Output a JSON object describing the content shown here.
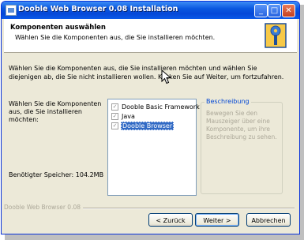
{
  "window": {
    "title": "Dooble Web Browser 0.08 Installation",
    "minimize_glyph": "_",
    "maximize_glyph": "□",
    "close_glyph": "✕"
  },
  "header": {
    "title": "Komponenten auswählen",
    "subtitle": "Wählen Sie die Komponenten aus, die Sie installieren möchten."
  },
  "intro_text": "Wählen Sie die Komponenten aus, die Sie installieren möchten und wählen Sie diejenigen ab, die Sie nicht installieren wollen. Klicken Sie auf Weiter, um fortzufahren.",
  "components": {
    "label": "Wählen Sie die Komponenten aus, die Sie installieren möchten:",
    "items": [
      {
        "label": "Dooble Basic Framework",
        "checked": true,
        "selected": false
      },
      {
        "label": "Java",
        "checked": true,
        "selected": false
      },
      {
        "label": "Dooble Browser",
        "checked": true,
        "selected": true
      }
    ]
  },
  "description": {
    "title": "Beschreibung",
    "text": "Bewegen Sie den Mauszeiger über eine Komponente, um ihre Beschreibung zu sehen."
  },
  "required_space": "Benötigter Speicher: 104.2MB",
  "branding": "Dooble Web Browser 0.08",
  "buttons": {
    "back": "< Zurück",
    "next": "Weiter >",
    "cancel": "Abbrechen"
  },
  "check_glyph": "✓"
}
